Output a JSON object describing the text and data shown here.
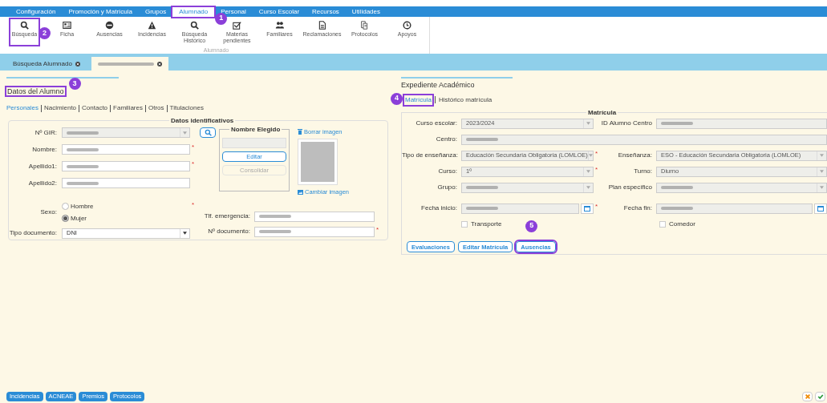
{
  "menu": [
    {
      "label": "Configuración",
      "selected": false
    },
    {
      "label": "Promoción y Matrícula",
      "selected": false
    },
    {
      "label": "Grupos",
      "selected": false
    },
    {
      "label": "Alumnado",
      "selected": true,
      "callout": "1"
    },
    {
      "label": "Personal",
      "selected": false
    },
    {
      "label": "Curso Escolar",
      "selected": false
    },
    {
      "label": "Recursos",
      "selected": false
    },
    {
      "label": "Utilidades",
      "selected": false
    }
  ],
  "toolbar": {
    "group_label": "Alumnado",
    "items": [
      {
        "label": "Búsqueda",
        "callout": "2"
      },
      {
        "label": "Ficha"
      },
      {
        "label": "Ausencias"
      },
      {
        "label": "Incidencias"
      },
      {
        "label": "Búsqueda Histórico"
      },
      {
        "label": "Materias pendientes"
      },
      {
        "label": "Familiares"
      },
      {
        "label": "Reclamaciones"
      },
      {
        "label": "Protocolos"
      },
      {
        "label": "Apoyos"
      }
    ]
  },
  "tabs": [
    {
      "label": "Búsqueda Alumnado",
      "selected": false,
      "blurred": false
    },
    {
      "selected": true,
      "blurred": true
    }
  ],
  "student": {
    "title": "Datos del Alumno",
    "callout": "3",
    "subtabs": [
      {
        "label": "Personales",
        "selected": true
      },
      {
        "label": "Nacimiento",
        "selected": false
      },
      {
        "label": "Contacto",
        "selected": false
      },
      {
        "label": "Familiares",
        "selected": false
      },
      {
        "label": "Otros",
        "selected": false
      },
      {
        "label": "Titulaciones",
        "selected": false
      }
    ],
    "section_title": "Datos identificativos",
    "fields": [
      {
        "label": "Nº GIR:",
        "kind": "select",
        "disabled": true,
        "blurred": true
      },
      {
        "label": "Nombre:",
        "kind": "text",
        "disabled": false,
        "blurred": true,
        "required_mark": "*"
      },
      {
        "label": "Apellido1:",
        "kind": "text",
        "disabled": false,
        "blurred": true,
        "required_mark": "*"
      },
      {
        "label": "Apellido2:",
        "kind": "text",
        "disabled": false,
        "blurred": true
      },
      {
        "label": "Sexo:",
        "kind": "radio",
        "required_mark": "*",
        "options": [
          {
            "label": "Hombre",
            "selected": false
          },
          {
            "label": "Mujer",
            "selected": true
          }
        ]
      },
      {
        "label": "Tipo documento:",
        "kind": "select",
        "disabled": false,
        "blurred": false,
        "value": "DNI"
      }
    ],
    "side_fields": [
      {
        "label": "Tlf. emergencia:",
        "kind": "text",
        "disabled": false,
        "blurred": true
      },
      {
        "label": "Nº documento:",
        "kind": "text",
        "disabled": false,
        "blurred": true,
        "required_mark": "*"
      }
    ],
    "chosen_name": {
      "title": "Nombre Elegido",
      "buttons": [
        {
          "label": "Editar",
          "disabled": false
        },
        {
          "label": "Consolidar",
          "disabled": true
        }
      ]
    },
    "photo": {
      "delete_link": "Borrar imagen",
      "change_link": "Cambiar imagen"
    }
  },
  "record": {
    "title": "Expediente Académico",
    "subtabs": [
      {
        "label": "Matrícula",
        "selected": true,
        "callout": "4"
      },
      {
        "label": "Histórico matrícula",
        "selected": false
      }
    ],
    "section_title": "Matrícula",
    "rows": [
      [
        {
          "label": "Curso escolar:",
          "kind": "select",
          "value": "2023/2024",
          "blurred": false
        },
        {
          "label": "ID Alumno Centro",
          "kind": "text",
          "blurred": true
        }
      ],
      [
        {
          "label": "Centro:",
          "kind": "text",
          "blurred": true
        }
      ],
      [
        {
          "label": "Tipo de enseñanza:",
          "kind": "select",
          "value": "Educación Secundaria Obligatoria (LOMLOE)",
          "blurred": false,
          "required_mark": "*"
        },
        {
          "label": "Enseñanza:",
          "kind": "select",
          "value": "ESO - Educación Secundaria Obligatoria (LOMLOE)",
          "blurred": false
        }
      ],
      [
        {
          "label": "Curso:",
          "kind": "select",
          "value": "1º",
          "blurred": false,
          "required_mark": "*"
        },
        {
          "label": "Turno:",
          "kind": "select",
          "value": "Diurno",
          "blurred": false
        }
      ],
      [
        {
          "label": "Grupo:",
          "kind": "select",
          "blurred": true
        },
        {
          "label": "Plan específico",
          "kind": "select",
          "blurred": true
        }
      ],
      [
        {
          "label": "Fecha inicio:",
          "kind": "date",
          "blurred": true,
          "required_mark": "*"
        },
        {
          "label": "Fecha fin:",
          "kind": "date",
          "blurred": true
        }
      ],
      [
        {
          "label": "Transporte",
          "kind": "checkbox",
          "checked": false
        },
        {
          "label": "Comedor",
          "kind": "checkbox",
          "checked": false
        }
      ]
    ],
    "buttons": [
      {
        "label": "Evaluaciones"
      },
      {
        "label": "Editar Matrícula"
      },
      {
        "label": "Ausencias",
        "callout": "5"
      }
    ]
  },
  "footer": {
    "buttons": [
      "Incidencias",
      "ACNEAE",
      "Premios",
      "Protocolos"
    ],
    "actions": [
      {
        "kind": "cancel"
      },
      {
        "kind": "confirm"
      }
    ]
  }
}
